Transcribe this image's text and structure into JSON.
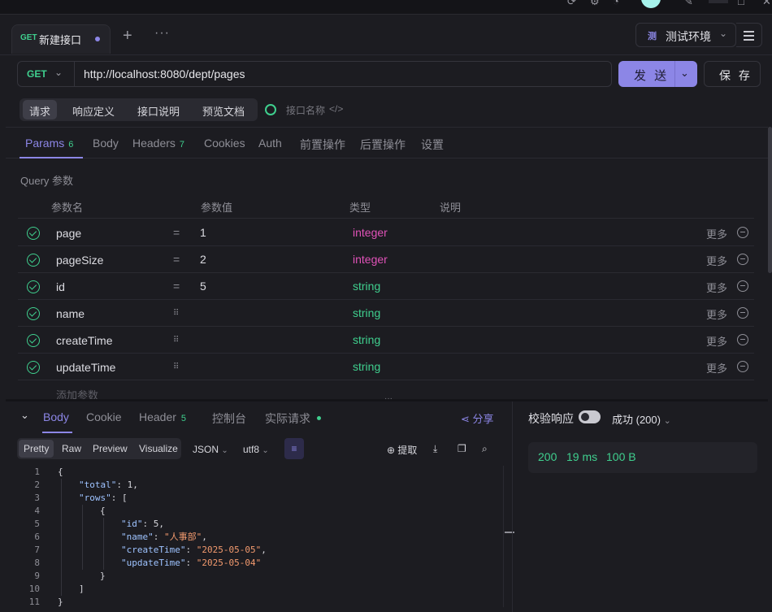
{
  "tab": {
    "method": "GET",
    "title": "新建接口"
  },
  "env": {
    "icon": "测",
    "label": "测试环境"
  },
  "request": {
    "method": "GET",
    "url": "http://localhost:8080/dept/pages",
    "send_label": "发 送",
    "save_label": "保 存"
  },
  "subtabs": [
    "请求",
    "响应定义",
    "接口说明",
    "预览文档"
  ],
  "interface_name_placeholder": "接口名称",
  "interface_code_glyph": "</>",
  "param_tabs": [
    {
      "label": "Params",
      "count": "6"
    },
    {
      "label": "Body",
      "count": ""
    },
    {
      "label": "Headers",
      "count": "7"
    },
    {
      "label": "Cookies",
      "count": ""
    },
    {
      "label": "Auth",
      "count": ""
    },
    {
      "label": "前置操作",
      "count": ""
    },
    {
      "label": "后置操作",
      "count": ""
    },
    {
      "label": "设置",
      "count": ""
    }
  ],
  "query_label": "Query 参数",
  "table_headers": [
    "参数名",
    "参数值",
    "类型",
    "说明"
  ],
  "params": [
    {
      "name": "page",
      "sep": "=",
      "value": "1",
      "type": "integer",
      "more": "更多"
    },
    {
      "name": "pageSize",
      "sep": "=",
      "value": "2",
      "type": "integer",
      "more": "更多"
    },
    {
      "name": "id",
      "sep": "=",
      "value": "5",
      "type": "string",
      "more": "更多"
    },
    {
      "name": "name",
      "sep": "⠿",
      "value": "",
      "type": "string",
      "more": "更多"
    },
    {
      "name": "createTime",
      "sep": "⠿",
      "value": "",
      "type": "string",
      "more": "更多"
    },
    {
      "name": "updateTime",
      "sep": "⠿",
      "value": "",
      "type": "string",
      "more": "更多"
    }
  ],
  "add_param": "添加参数",
  "response_tabs": [
    {
      "label": "Body",
      "count": ""
    },
    {
      "label": "Cookie",
      "count": ""
    },
    {
      "label": "Header",
      "count": "5"
    },
    {
      "label": "控制台",
      "count": ""
    },
    {
      "label": "实际请求",
      "count": ""
    }
  ],
  "share_label": "分享",
  "formats": [
    "Pretty",
    "Raw",
    "Preview",
    "Visualize"
  ],
  "format_select": "JSON",
  "encoding_select": "utf8",
  "extract_label": "提取",
  "code_lines": [
    {
      "n": "1",
      "indent": 0,
      "text": "{"
    },
    {
      "n": "2",
      "indent": 1,
      "key": "\"total\"",
      "rest": ": 1,"
    },
    {
      "n": "3",
      "indent": 1,
      "key": "\"rows\"",
      "rest": ": ["
    },
    {
      "n": "4",
      "indent": 2,
      "text": "{"
    },
    {
      "n": "5",
      "indent": 3,
      "key": "\"id\"",
      "rest": ": 5,"
    },
    {
      "n": "6",
      "indent": 3,
      "key": "\"name\"",
      "rest": ": ",
      "str": "\"人事部\"",
      "tail": ","
    },
    {
      "n": "7",
      "indent": 3,
      "key": "\"createTime\"",
      "rest": ": ",
      "str": "\"2025-05-05\"",
      "tail": ","
    },
    {
      "n": "8",
      "indent": 3,
      "key": "\"updateTime\"",
      "rest": ": ",
      "str": "\"2025-05-04\"",
      "tail": ""
    },
    {
      "n": "9",
      "indent": 2,
      "text": "}"
    },
    {
      "n": "10",
      "indent": 1,
      "text": "]"
    },
    {
      "n": "11",
      "indent": 0,
      "text": "}"
    }
  ],
  "validate_label": "校验响应",
  "result_select": "成功 (200)",
  "status": {
    "code": "200",
    "time": "19 ms",
    "size": "100 B"
  },
  "colors": {
    "accent": "#8c86e6",
    "green": "#3fcf8e",
    "integer": "#e052b8",
    "string": "#3fcf8e"
  }
}
